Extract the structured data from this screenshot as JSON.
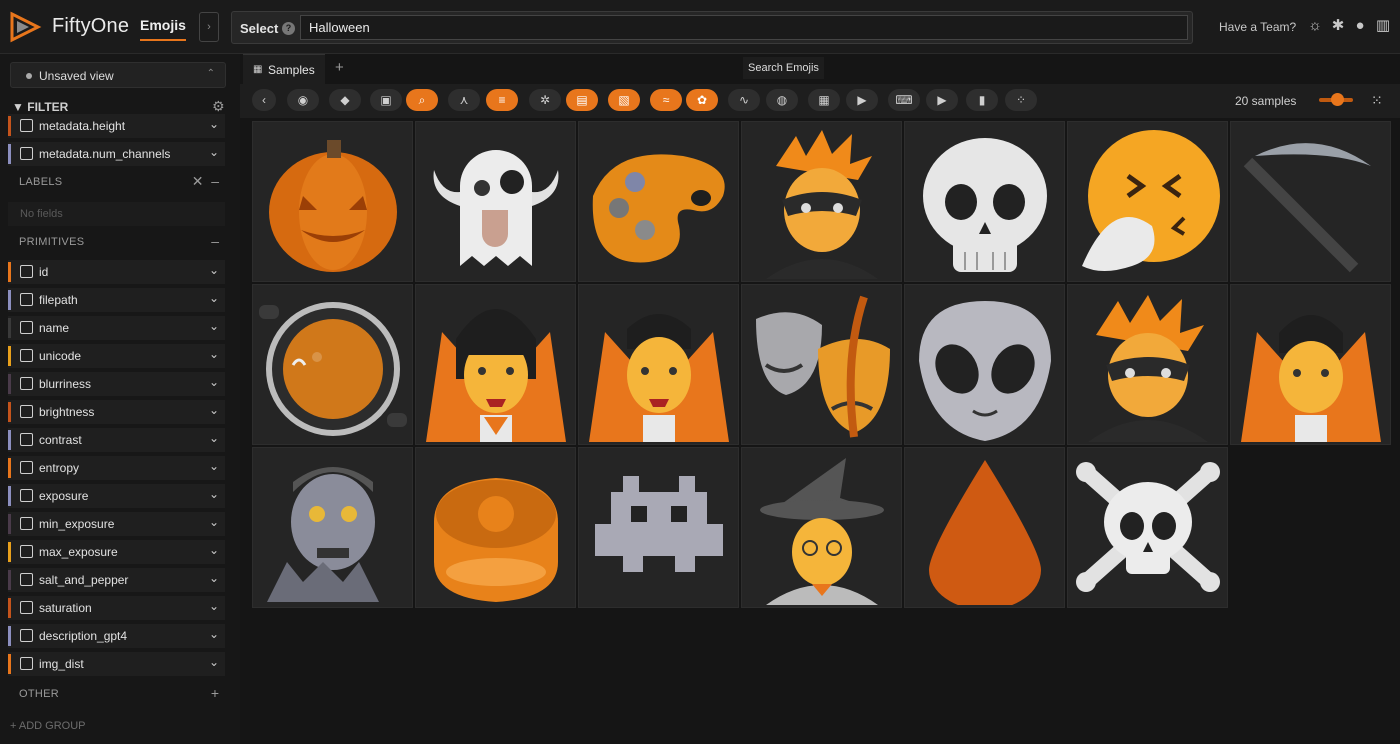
{
  "header": {
    "brand": "FiftyOne",
    "dataset": "Emojis",
    "select_label": "Select",
    "query": "Halloween",
    "team_link": "Have a Team?",
    "icons": [
      "theme-icon",
      "slack-icon",
      "github-icon",
      "book-icon"
    ]
  },
  "sidebar": {
    "view": "Unsaved view",
    "filter_title": "FILTER",
    "top_fields": [
      {
        "label": "metadata.height",
        "color": "#c4541c"
      },
      {
        "label": "metadata.num_channels",
        "color": "#8c8fbf"
      }
    ],
    "labels_section": "LABELS",
    "no_fields": "No fields",
    "primitives_section": "PRIMITIVES",
    "primitives": [
      {
        "label": "id",
        "color": "#e8761c"
      },
      {
        "label": "filepath",
        "color": "#8c8fbf"
      },
      {
        "label": "name",
        "color": "#3a3a3a"
      },
      {
        "label": "unicode",
        "color": "#e8a01c"
      },
      {
        "label": "blurriness",
        "color": "#4a3b4a"
      },
      {
        "label": "brightness",
        "color": "#c4541c"
      },
      {
        "label": "contrast",
        "color": "#8c8fbf"
      },
      {
        "label": "entropy",
        "color": "#e8761c"
      },
      {
        "label": "exposure",
        "color": "#8c8fbf"
      },
      {
        "label": "min_exposure",
        "color": "#4a3b4a"
      },
      {
        "label": "max_exposure",
        "color": "#e8a01c"
      },
      {
        "label": "salt_and_pepper",
        "color": "#4a3b4a"
      },
      {
        "label": "saturation",
        "color": "#c4541c"
      },
      {
        "label": "description_gpt4",
        "color": "#8c8fbf"
      },
      {
        "label": "img_dist",
        "color": "#e8761c"
      }
    ],
    "other_section": "OTHER",
    "add_group": "+ ADD GROUP"
  },
  "tabs": {
    "samples": "Samples",
    "tooltip": "Search Emojis"
  },
  "actions": [
    {
      "name": "back-button",
      "icon": "‹",
      "on": false
    },
    {
      "name": "color-palette-button",
      "icon": "◉",
      "on": false
    },
    {
      "name": "tag-button",
      "icon": "◆",
      "on": false
    },
    {
      "name": "patches-button",
      "icon": "▣",
      "on": false
    },
    {
      "name": "search-emojis-button",
      "icon": "⌕",
      "on": true
    },
    {
      "name": "similarity-button",
      "icon": "⋏",
      "on": false
    },
    {
      "name": "list-button",
      "icon": "≡",
      "on": true
    },
    {
      "name": "settings-button",
      "icon": "✲",
      "on": false
    },
    {
      "name": "image-button",
      "icon": "▤",
      "on": true
    },
    {
      "name": "picture-button",
      "icon": "▧",
      "on": true
    },
    {
      "name": "wave-button",
      "icon": "≈",
      "on": true
    },
    {
      "name": "openai-button",
      "icon": "✿",
      "on": true
    },
    {
      "name": "curve-button",
      "icon": "∿",
      "on": false
    },
    {
      "name": "brain-button",
      "icon": "◍",
      "on": false
    },
    {
      "name": "grid-plugin-button",
      "icon": "▦",
      "on": false
    },
    {
      "name": "youtube-button",
      "icon": "▶",
      "on": false
    },
    {
      "name": "keyboard-button",
      "icon": "⌨",
      "on": false
    },
    {
      "name": "youtube2-button",
      "icon": "▶",
      "on": false
    },
    {
      "name": "histogram-button",
      "icon": "▮",
      "on": false
    },
    {
      "name": "embeddings-button",
      "icon": "⁘",
      "on": false
    }
  ],
  "sample_count": "20 samples",
  "samples": [
    "jack-o-lantern",
    "ghost",
    "artist-palette",
    "supervillain",
    "skull",
    "sneezing-face",
    "pick",
    "frying-pan",
    "woman-vampire",
    "man-vampire",
    "performing-arts",
    "alien",
    "supervillain-2",
    "vampire",
    "zombie",
    "moon-cake",
    "alien-monster",
    "witch",
    "drop-of-blood",
    "skull-and-crossbones"
  ]
}
